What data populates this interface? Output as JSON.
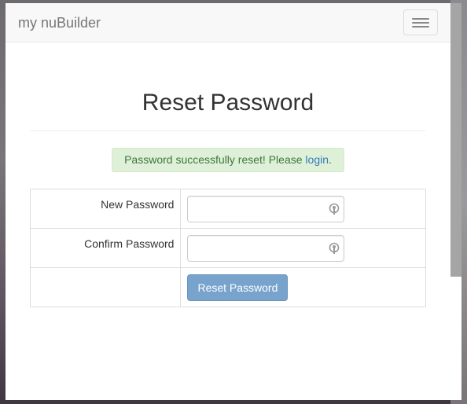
{
  "navbar": {
    "brand": "my nuBuilder"
  },
  "page": {
    "title": "Reset Password"
  },
  "alert": {
    "message": "Password successfully reset! Please ",
    "link_text": "login",
    "suffix": "."
  },
  "form": {
    "new_password_label": "New Password",
    "new_password_value": "",
    "confirm_password_label": "Confirm Password",
    "confirm_password_value": "",
    "submit_label": "Reset Password"
  },
  "colors": {
    "alert_bg": "#dff0d8",
    "alert_text": "#3c763d",
    "link": "#337ab7",
    "button_bg": "#78a3cc"
  },
  "icons": {
    "password_field": "key-icon",
    "menu": "hamburger-menu-icon"
  }
}
